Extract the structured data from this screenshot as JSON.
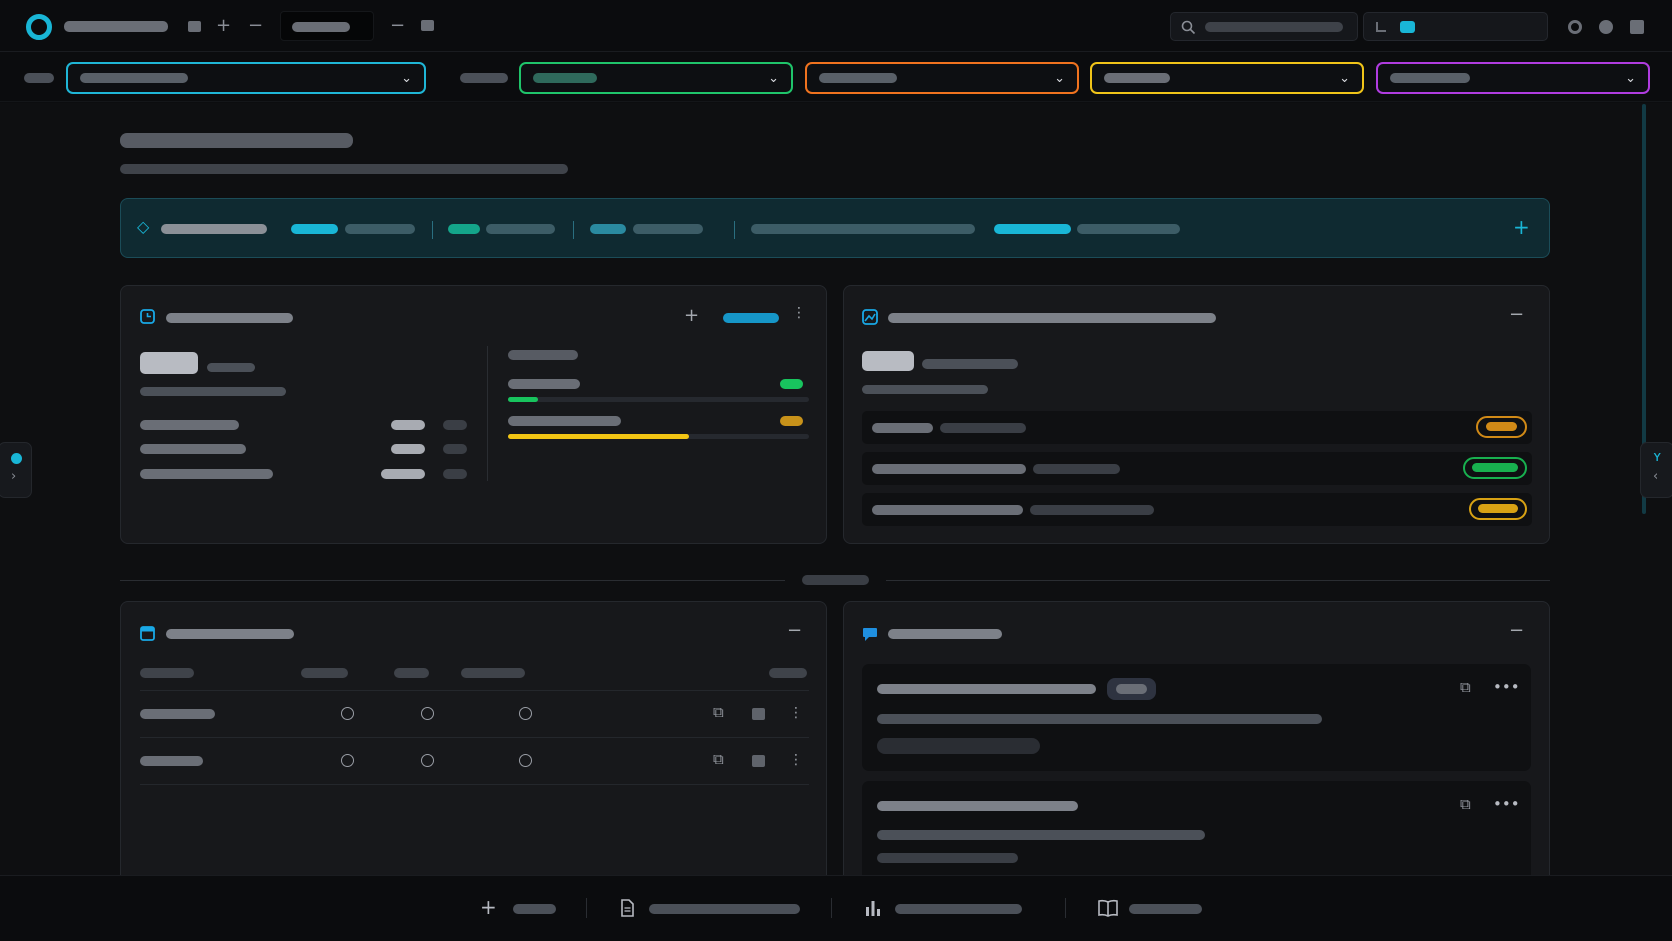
{
  "topbar": {
    "app_icon": "app-logo-icon",
    "window_icons": [
      "square-icon",
      "plus-icon",
      "minus-icon",
      "minus-icon",
      "square-icon"
    ],
    "search_icon": "search-icon",
    "right_icons": [
      "gear-icon",
      "circle-icon",
      "square-icon"
    ]
  },
  "filters": {
    "colors": [
      "#1fb6d6",
      "#1fc46a",
      "#f0731f",
      "#f0c419",
      "#b03ce0"
    ],
    "chevron": "chevron-down-icon"
  },
  "summary_strip": {
    "accent": "#19b6d6",
    "segment_colors": [
      "#19b6d6",
      "#14a58a",
      "#2a8aa0",
      "#19b6d6"
    ],
    "add_icon": "plus-icon"
  },
  "progress": {
    "green": {
      "color": "#18c45e",
      "fraction": 0.1
    },
    "yellow": {
      "color": "#f2c514",
      "fraction": 0.6
    }
  },
  "status_pills": [
    {
      "color": "#d18a17"
    },
    {
      "color": "#18b04f"
    },
    {
      "color": "#d8a214"
    }
  ],
  "bottombar": {
    "icons": [
      "plus-icon",
      "document-icon",
      "bar-chart-icon",
      "book-icon"
    ]
  }
}
